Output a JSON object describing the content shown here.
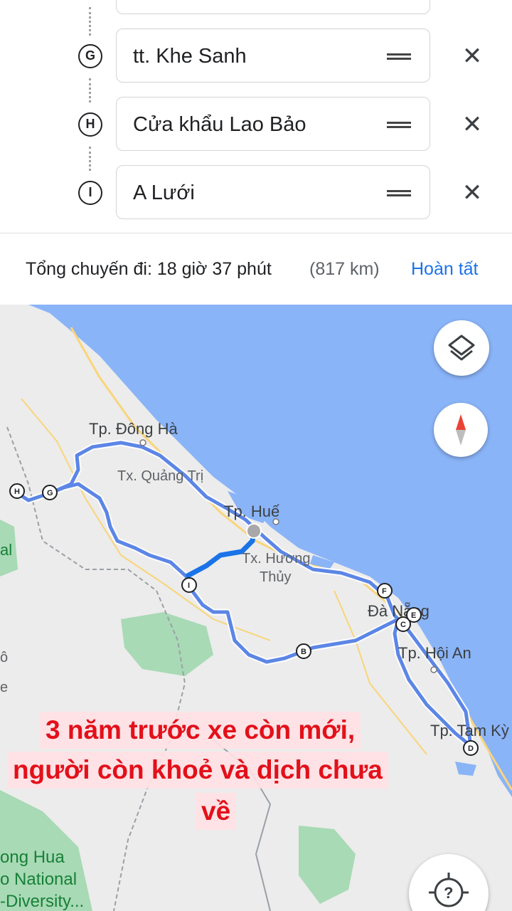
{
  "stops": [
    {
      "marker": "G",
      "value": "tt. Khe Sanh"
    },
    {
      "marker": "H",
      "value": "Cửa khẩu Lao Bảo"
    },
    {
      "marker": "I",
      "value": "A Lưới"
    }
  ],
  "summary": {
    "trip_label": "Tổng chuyến đi: 18 giờ 37 phút",
    "distance": "(817 km)",
    "done_label": "Hoàn tất"
  },
  "map": {
    "places": {
      "dong_ha": "Tp. Đông Hà",
      "quang_tri": "Tx. Quảng Trị",
      "hue": "Tp. Huế",
      "huong_thuy_1": "Tx. Hương",
      "huong_thuy_2": "Thủy",
      "da_nang": "Đà Nẵng",
      "hoi_an": "Tp. Hội An",
      "tam_ky": "Tp. Tam Kỳ",
      "park_1": "ong Hua",
      "park_2": "o National",
      "park_3": "-Diversity...",
      "edge_1": "al",
      "edge_2": "ô",
      "edge_3": "e"
    },
    "waypoints": [
      "B",
      "C",
      "D",
      "E",
      "F",
      "G",
      "H",
      "I"
    ],
    "route_color": "#5c86e6",
    "water_color": "#8ab4f8",
    "land_color": "#ececec"
  },
  "overlay_text": {
    "line1": "3 năm trước xe còn mới,",
    "line2": "người còn khoẻ và dịch chưa",
    "line3": "về"
  },
  "buttons": {
    "help_glyph": "?"
  }
}
